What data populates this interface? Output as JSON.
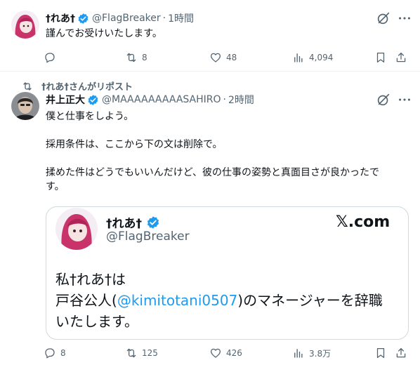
{
  "tweet1": {
    "name": "†れあ†",
    "handle": "@FlagBreaker",
    "dot": "·",
    "time": "1時間",
    "text": "謹んでお受けいたします。",
    "stats": {
      "replies": "",
      "retweets": "8",
      "likes": "48",
      "views": "4,094"
    }
  },
  "retweet_banner": {
    "text": "†れあ†さんがリポスト"
  },
  "tweet2": {
    "name": "井上正大",
    "handle": "@MAAAAAAAAASAHIRO",
    "dot": "·",
    "time": "2時間",
    "line1": "僕と仕事をしよう。",
    "line2": "採用条件は、ここから下の文は削除で。",
    "line3": "揉めた件はどうでもいいんだけど、彼の仕事の姿勢と真面目さが良かったで",
    "line4": "す。",
    "stats": {
      "replies": "8",
      "retweets": "125",
      "likes": "426",
      "views": "3.8万"
    }
  },
  "card": {
    "name": "†れあ†",
    "handle": "@FlagBreaker",
    "logo": "𝕏.com",
    "line1": "私†れあ†は",
    "line2_pre": "戸谷公人(",
    "mention": "@kimitotani0507",
    "line2_post": ")のマネージャーを辞職",
    "line3": "いたします。"
  },
  "colors": {
    "accent": "#1d9bf0",
    "muted": "#536471",
    "border": "#cfd9de"
  },
  "icons": [
    "verified-badge-icon",
    "grok-icon",
    "more-icon",
    "reply-icon",
    "retweet-icon",
    "like-icon",
    "views-icon",
    "bookmark-icon",
    "share-icon"
  ]
}
